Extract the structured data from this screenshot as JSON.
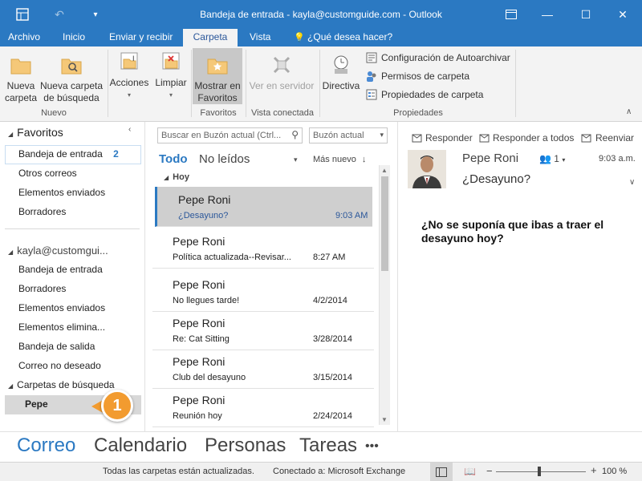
{
  "window": {
    "title": "Bandeja de entrada - kayla@customguide.com - Outlook",
    "icons": [
      "outlook-app-icon",
      "undo-icon",
      "quick-access-dropdown-icon",
      "ribbon-display-options-icon",
      "minimize-icon",
      "maximize-icon",
      "close-icon"
    ]
  },
  "tabs": [
    {
      "label": "Archivo"
    },
    {
      "label": "Inicio"
    },
    {
      "label": "Enviar y recibir"
    },
    {
      "label": "Carpeta"
    },
    {
      "label": "Vista"
    }
  ],
  "tell_me": "¿Qué desea hacer?",
  "ribbon": {
    "nuevo": {
      "btn1": "Nueva carpeta",
      "btn2": "Nueva carpeta de búsqueda",
      "label": "Nuevo"
    },
    "acciones": {
      "label": "Acciones"
    },
    "limpiar": {
      "label": "Limpiar"
    },
    "favoritos": {
      "btn": "Mostrar en Favoritos",
      "label": "Favoritos"
    },
    "vista_conectada": {
      "btn": "Ver en servidor",
      "label": "Vista conectada"
    },
    "propiedades": {
      "directiva": "Directiva",
      "autoarchivar": "Configuración de Autoarchivar",
      "permisos": "Permisos de carpeta",
      "propiedades": "Propiedades de carpeta",
      "label": "Propiedades"
    }
  },
  "nav": {
    "favoritos_header": "Favoritos",
    "favoritos": [
      {
        "label": "Bandeja de entrada",
        "count": "2"
      },
      {
        "label": "Otros correos"
      },
      {
        "label": "Elementos enviados"
      },
      {
        "label": "Borradores"
      }
    ],
    "account_header": "kayla@customgui...",
    "account": [
      {
        "label": "Bandeja de entrada"
      },
      {
        "label": "Borradores"
      },
      {
        "label": "Elementos enviados"
      },
      {
        "label": "Elementos elimina..."
      },
      {
        "label": "Bandeja de salida"
      },
      {
        "label": "Correo no deseado"
      }
    ],
    "search_folders": "Carpetas de búsqueda",
    "selected_folder": "Pepe"
  },
  "list": {
    "search_placeholder": "Buscar en Buzón actual (Ctrl...",
    "scope": "Buzón actual",
    "filter_all": "Todo",
    "filter_unread": "No leídos",
    "sort": "Más nuevo",
    "group": "Hoy",
    "messages": [
      {
        "from": "Pepe Roni",
        "subject": "¿Desayuno?",
        "date": "9:03 AM"
      },
      {
        "from": "Pepe Roni",
        "subject": "Política actualizada--Revisar...",
        "date": "8:27 AM"
      },
      {
        "from": "Pepe Roni",
        "subject": "No llegues tarde!",
        "date": "4/2/2014"
      },
      {
        "from": "Pepe Roni",
        "subject": "Re: Cat Sitting",
        "date": "3/28/2014"
      },
      {
        "from": "Pepe Roni",
        "subject": "Club del desayuno",
        "date": "3/15/2014"
      },
      {
        "from": "Pepe Roni",
        "subject": "Reunión hoy",
        "date": "2/24/2014"
      }
    ]
  },
  "reading": {
    "reply": "Responder",
    "reply_all": "Responder a todos",
    "forward": "Reenviar",
    "sender": "Pepe Roni",
    "recipients": "1",
    "time": "9:03 a.m.",
    "subject": "¿Desayuno?",
    "body": "¿No se suponía que ibas a traer el desayuno hoy?"
  },
  "bottom_nav": [
    "Correo",
    "Calendario",
    "Personas",
    "Tareas",
    "•••"
  ],
  "status": {
    "left": "Todas las carpetas están actualizadas.",
    "connection": "Conectado a: Microsoft Exchange",
    "zoom": "100 %"
  },
  "callout": "1",
  "colors": {
    "accent": "#2b79c2",
    "callout": "#f29b2f",
    "selected_row": "#cfcfcf"
  }
}
